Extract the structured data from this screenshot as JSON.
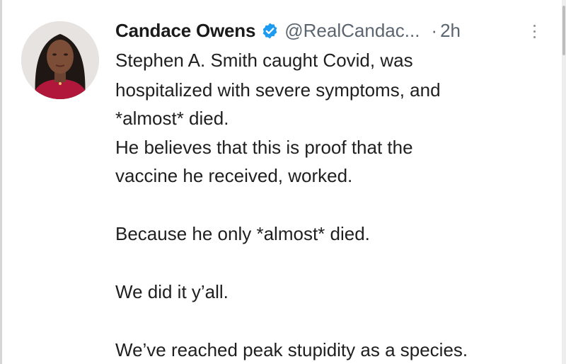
{
  "tweet": {
    "author_name": "Candace Owens",
    "handle": "@RealCandac...",
    "separator": "·",
    "time": "2h",
    "lines": [
      "Stephen A. Smith caught Covid, was",
      "hospitalized with severe symptoms, and",
      "*almost* died.",
      "He believes that this is proof that the",
      "vaccine he received, worked.",
      "Because he only *almost* died.",
      "We did it y’all.",
      "We’ve reached peak stupidity as a species."
    ]
  },
  "colors": {
    "verified_blue": "#1d9bf0",
    "muted_text": "#5b6570",
    "main_text": "#1f1f1f"
  },
  "icons": {
    "verified": "verified-badge-icon",
    "more": "more-options-icon"
  }
}
